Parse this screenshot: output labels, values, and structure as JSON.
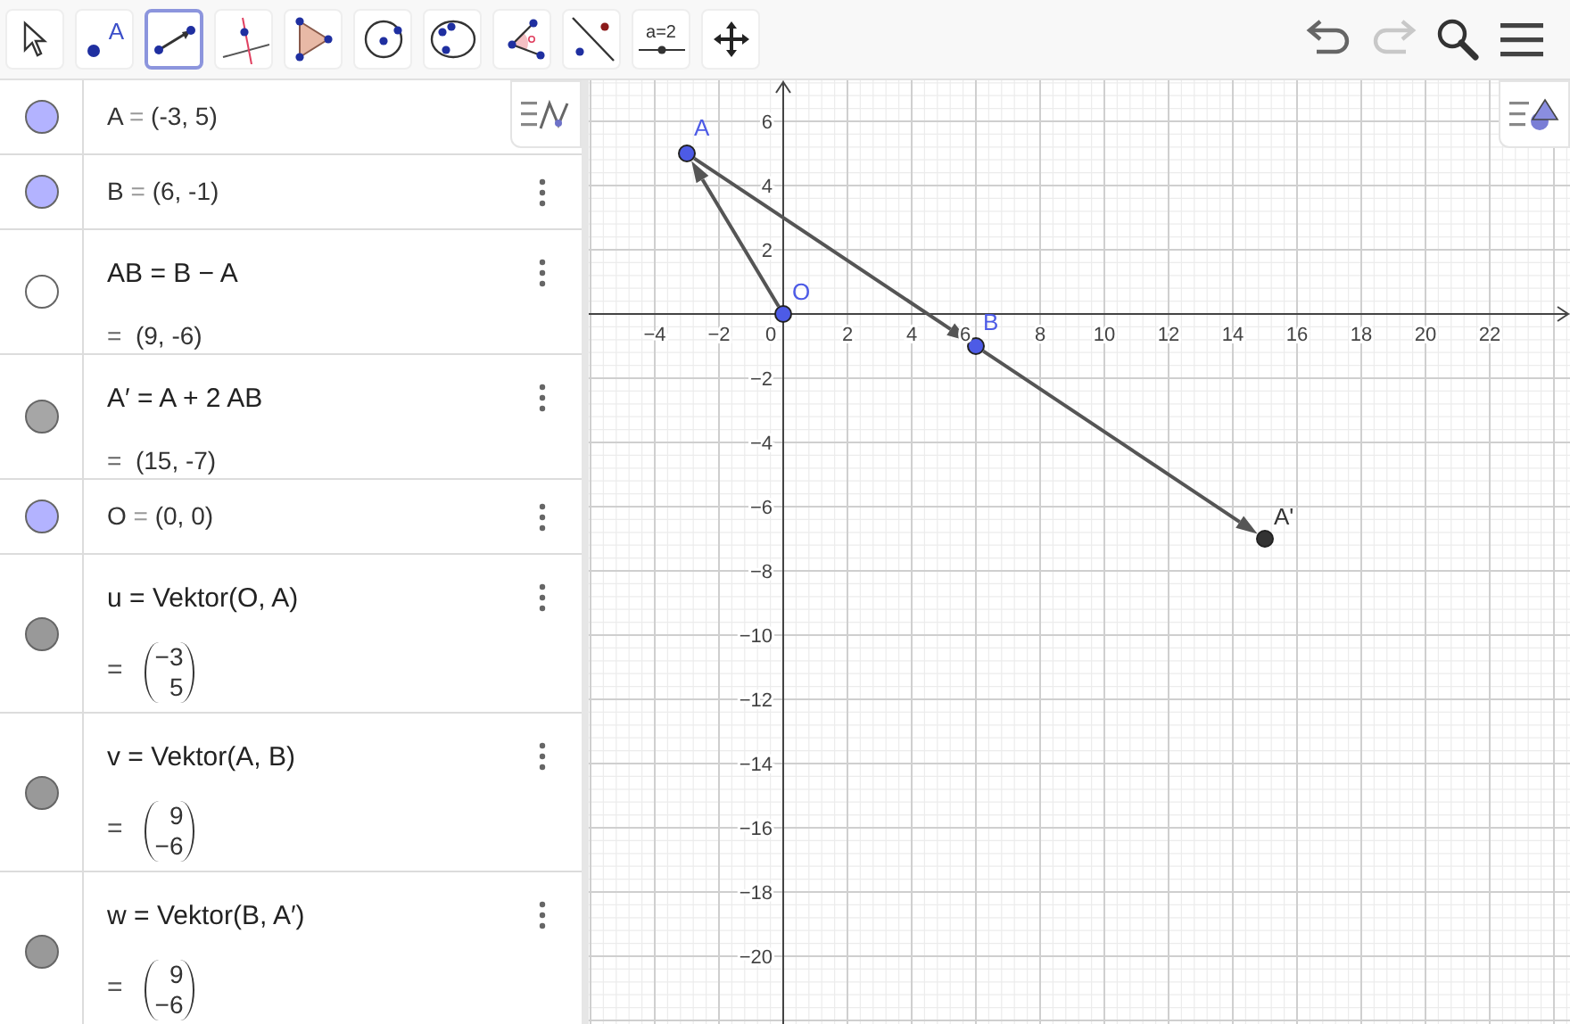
{
  "toolbar": {
    "tools": [
      {
        "kind": "move",
        "selected": false
      },
      {
        "kind": "point",
        "selected": false,
        "text": "A"
      },
      {
        "kind": "vector",
        "selected": true
      },
      {
        "kind": "perpendicular",
        "selected": false
      },
      {
        "kind": "polygon",
        "selected": false
      },
      {
        "kind": "circle-center",
        "selected": false
      },
      {
        "kind": "circle-three",
        "selected": false
      },
      {
        "kind": "angle",
        "selected": false
      },
      {
        "kind": "reflect",
        "selected": false
      },
      {
        "kind": "slider",
        "selected": false,
        "text": "a=2"
      },
      {
        "kind": "pan",
        "selected": false
      }
    ],
    "actions": [
      {
        "kind": "undo",
        "disabled": false
      },
      {
        "kind": "redo",
        "disabled": true
      },
      {
        "kind": "search"
      },
      {
        "kind": "menu"
      }
    ]
  },
  "algebra": {
    "rows": [
      {
        "kind": "single",
        "name": "A",
        "eq": "=",
        "value": "(-3, 5)",
        "color": "#b3b3ff",
        "menu": false
      },
      {
        "kind": "single",
        "name": "B",
        "eq": "=",
        "value": "(6, -1)",
        "color": "#b3b3ff",
        "menu": true
      },
      {
        "kind": "expression",
        "name": "AB",
        "eq": "=",
        "definition": "B − A",
        "result_eq": "=",
        "result": "(9, -6)",
        "color": "#ffffff",
        "menu": true
      },
      {
        "kind": "expression",
        "name": "A′",
        "eq": "=",
        "definition": "A + 2 AB",
        "result_eq": "=",
        "result": "(15, -7)",
        "color": "#a6a6a6",
        "menu": true
      },
      {
        "kind": "single",
        "name": "O",
        "eq": "=",
        "value": "(0, 0)",
        "color": "#b3b3ff",
        "menu": true
      },
      {
        "kind": "vector",
        "name": "u",
        "eq": "=",
        "definition": "Vektor(O, A)",
        "result_eq": "=",
        "entries": [
          "−3",
          "5"
        ],
        "color": "#999999",
        "menu": true
      },
      {
        "kind": "vector",
        "name": "v",
        "eq": "=",
        "definition": "Vektor(A, B)",
        "result_eq": "=",
        "entries": [
          "9",
          "−6"
        ],
        "color": "#999999",
        "menu": true
      },
      {
        "kind": "vector",
        "name": "w",
        "eq": "=",
        "definition": "Vektor(B, A′)",
        "result_eq": "=",
        "entries": [
          "9",
          "−6"
        ],
        "color": "#999999",
        "menu": true
      }
    ]
  },
  "graphics": {
    "x_ticks": [
      "−4",
      "−2",
      "2",
      "4",
      "6",
      "8",
      "10",
      "12",
      "14",
      "16",
      "18",
      "20",
      "22"
    ],
    "y_ticks": [
      "6",
      "4",
      "2",
      "−2",
      "−4",
      "−6",
      "−8",
      "−10",
      "−12",
      "−14",
      "−16",
      "−18",
      "−20"
    ],
    "origin_label": "0",
    "points": [
      {
        "label": "A",
        "color": "#4d5be6"
      },
      {
        "label": "O",
        "color": "#4d5be6"
      },
      {
        "label": "B",
        "color": "#4d5be6"
      },
      {
        "label": "A'",
        "color": "#333333"
      }
    ]
  }
}
